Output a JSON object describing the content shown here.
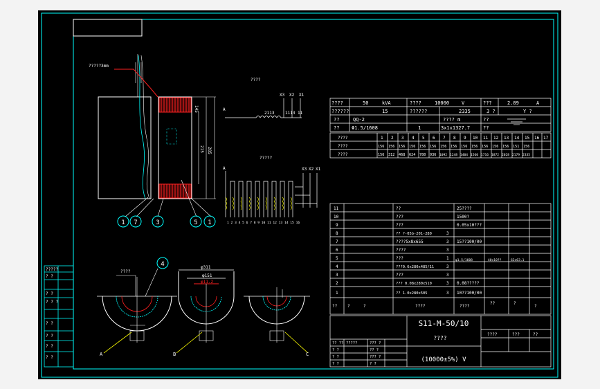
{
  "drawing": {
    "title": "S11-M-50/10",
    "subtitle": "????",
    "voltage": "(10000±5%) V",
    "note_top_left": "?????3mm",
    "label_connection": "????",
    "label_winding": "?????",
    "label_section_top": "????",
    "terminals": [
      "X3",
      "X2",
      "X1"
    ],
    "terminal_a": "A",
    "tap_code": "2113",
    "tap_nums": "1113 11",
    "dim_vertical_1": "145",
    "dim_vertical_2": "215",
    "dim_vertical_3": "285",
    "dim_dia_1": "φ311",
    "dim_dia_2": "φ151",
    "dim_dia_3": "φ11.2",
    "callouts": [
      "1",
      "7",
      "3",
      "5",
      "1",
      "4"
    ],
    "section_labels": [
      "A",
      "B",
      "C"
    ],
    "tap_numbers": "1 2 3 4 5 6 7 8 9 10 11 12 13 14 15 16",
    "lead_labels": [
      "X3",
      "X2",
      "X1"
    ]
  },
  "spec_table": {
    "row1": [
      "????",
      "50",
      "kVA",
      "????",
      "10000",
      "V",
      "???",
      "2.89",
      "A"
    ],
    "row2": [
      "??????",
      "15",
      "",
      "??????",
      "2335",
      "",
      "3 ?",
      "",
      "Y ?"
    ],
    "row3": [
      "??",
      "QQ-2",
      "",
      "???? m",
      "",
      "",
      "??",
      "",
      ""
    ],
    "row4": [
      "??",
      "Φ1.5/1608",
      "",
      "1",
      "3x1x1327.7",
      "",
      "??",
      "",
      ""
    ]
  },
  "tap_table": {
    "header": [
      "????",
      "1",
      "2",
      "3",
      "4",
      "5",
      "6",
      "7",
      "8",
      "9",
      "10",
      "11",
      "12",
      "13",
      "14",
      "15",
      "16",
      "17"
    ],
    "row1": [
      "????",
      "156",
      "156",
      "156",
      "156",
      "156",
      "156",
      "156",
      "156",
      "156",
      "156",
      "156",
      "156",
      "156",
      "151",
      "156",
      "",
      ""
    ],
    "row2": [
      "????",
      "156",
      "312",
      "468",
      "624",
      "780",
      "936",
      "1092",
      "1248",
      "1404",
      "1560",
      "1716",
      "1872",
      "2028",
      "2179",
      "2335",
      "",
      ""
    ]
  },
  "parts_table": {
    "rows": [
      [
        "11",
        "??",
        "25????"
      ],
      [
        "10",
        "???",
        "1500?"
      ],
      [
        "9",
        "???",
        "0.05x10???"
      ],
      [
        "8",
        "?? ?-05b-201-280",
        "3"
      ],
      [
        "7",
        "????5x8x655",
        "3",
        "15??100/00"
      ],
      [
        "6",
        "????",
        "3"
      ],
      [
        "5",
        "???",
        "1",
        "φ1.5/1608",
        "40x10??",
        "62x63.1"
      ],
      [
        "4",
        "???0.6x280x485/11",
        "3"
      ],
      [
        "3",
        "???",
        "3"
      ],
      [
        "2",
        "??? 0.08x280x510",
        "3",
        "0.08?????"
      ],
      [
        "1",
        "?? 1.0x280x505",
        "3",
        "10??100/00"
      ]
    ],
    "footer": [
      "??",
      "?",
      "?",
      "????",
      "????",
      "??",
      "?",
      "?"
    ]
  },
  "title_block": {
    "left_cells": [
      "?? ??",
      "?????",
      "??? ?",
      "? ?",
      "? ?",
      "? ?"
    ],
    "right_top": [
      "????",
      "???",
      "??"
    ],
    "sig_cells": [
      "?? ?",
      "??? ?",
      "? ?"
    ]
  },
  "side_block": {
    "cells": [
      "?????",
      "? ?",
      "? ?",
      "? ? ?",
      "? ?",
      "? ?",
      "? ?",
      "? ?"
    ]
  },
  "colors": {
    "frame": "#00ffff",
    "lines": "#ffffff",
    "red": "#ff2020",
    "yellow": "#ffff00",
    "green": "#00ff00",
    "background": "#000000"
  }
}
